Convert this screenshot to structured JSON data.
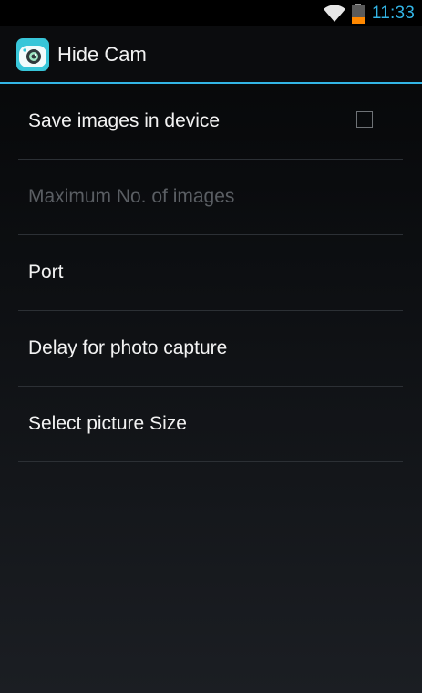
{
  "status_bar": {
    "time": "11:33",
    "icons": [
      "wifi-icon",
      "battery-icon"
    ],
    "accent_color": "#33b5e5",
    "battery_color": "#ff8800"
  },
  "action_bar": {
    "app_icon": "camera-app-icon",
    "title": "Hide Cam"
  },
  "preferences": [
    {
      "label": "Save images in device",
      "enabled": true,
      "checkbox": true,
      "checked": false
    },
    {
      "label": "Maximum No. of images",
      "enabled": false
    },
    {
      "label": "Port",
      "enabled": true
    },
    {
      "label": "Delay for photo capture",
      "enabled": true
    },
    {
      "label": "Select picture Size",
      "enabled": true
    }
  ]
}
